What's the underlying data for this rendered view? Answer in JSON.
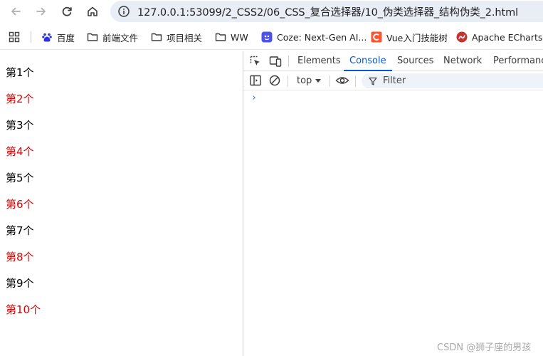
{
  "browser": {
    "url": "127.0.0.1:53099/2_CSS2/06_CSS_复合选择器/10_伪类选择器_结构伪类_2.html"
  },
  "bookmarks": [
    {
      "label": "百度",
      "icon": "baidu-icon"
    },
    {
      "label": "前端文件",
      "icon": "folder-icon"
    },
    {
      "label": "项目相关",
      "icon": "folder-icon"
    },
    {
      "label": "WW",
      "icon": "folder-icon"
    },
    {
      "label": "Coze: Next-Gen AI...",
      "icon": "coze-icon"
    },
    {
      "label": "Vue入门技能树",
      "icon": "csdn-icon"
    },
    {
      "label": "Apache ECharts",
      "icon": "echarts-icon"
    }
  ],
  "page": {
    "items": [
      "第1个",
      "第2个",
      "第3个",
      "第4个",
      "第5个",
      "第6个",
      "第7个",
      "第8个",
      "第9个",
      "第10个"
    ],
    "colors": {
      "odd": "#000000",
      "even": "#e00000"
    }
  },
  "devtools": {
    "tabs": [
      "Elements",
      "Console",
      "Sources",
      "Network",
      "Performance"
    ],
    "active_tab": "Console",
    "context": "top",
    "filter_placeholder": "Filter",
    "prompt": "›"
  },
  "watermark": "CSDN @狮子座的男孩"
}
